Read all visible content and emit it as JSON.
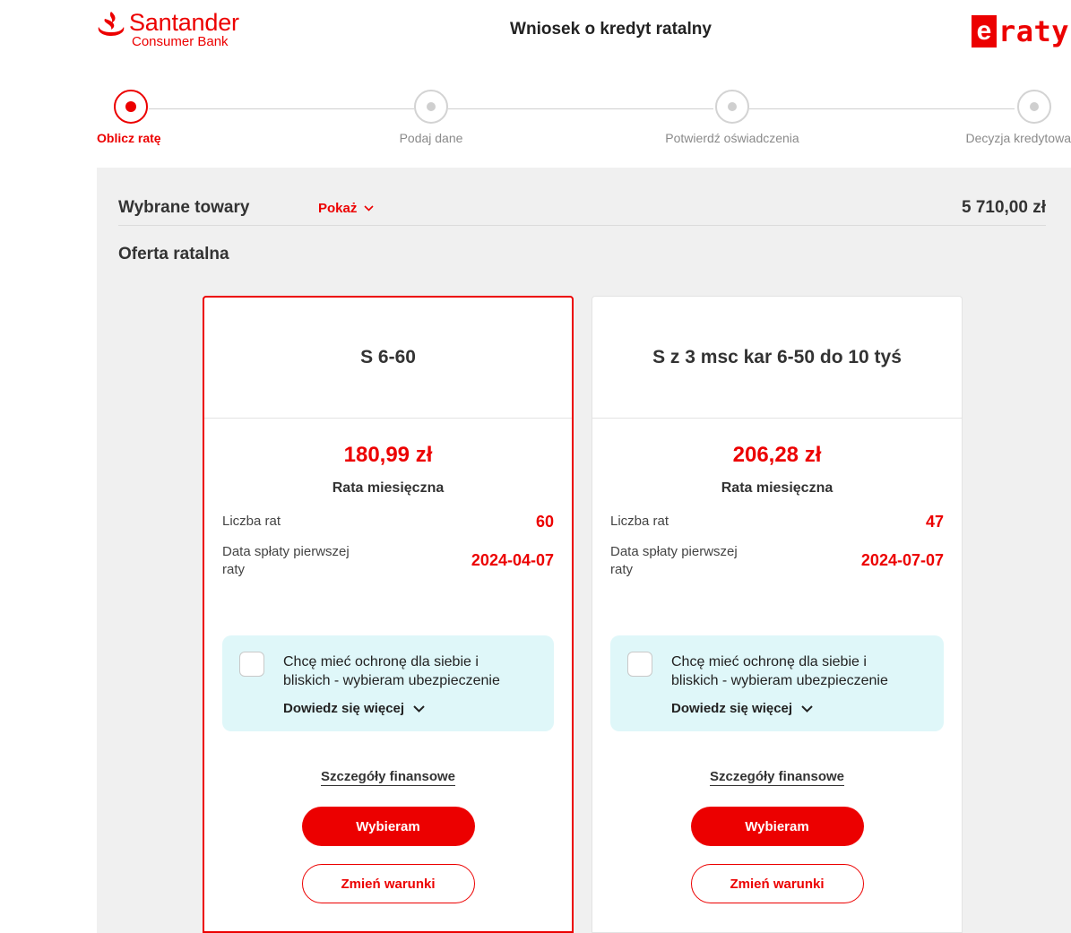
{
  "header": {
    "brand_main": "Santander",
    "brand_sub": "Consumer Bank",
    "title": "Wniosek o kredyt ratalny",
    "partner_logo_e": "e",
    "partner_logo_rest": "raty"
  },
  "stepper": {
    "steps": [
      {
        "label": "Oblicz ratę",
        "active": true
      },
      {
        "label": "Podaj dane",
        "active": false
      },
      {
        "label": "Potwierdź oświadczenia",
        "active": false
      },
      {
        "label": "Decyzja kredytowa",
        "active": false
      }
    ]
  },
  "goods": {
    "label": "Wybrane towary",
    "toggle_label": "Pokaż",
    "total": "5 710,00 zł"
  },
  "offer": {
    "title": "Oferta ratalna",
    "cards": [
      {
        "name": "S 6-60",
        "price": "180,99 zł",
        "price_label": "Rata miesięczna",
        "installments_label": "Liczba rat",
        "installments_value": "60",
        "first_payment_label": "Data spłaty pierwszej raty",
        "first_payment_value": "2024-04-07",
        "insurance_text": "Chcę mieć ochronę dla siebie i bliskich - wybieram ubezpieczenie",
        "insurance_more": "Dowiedz się więcej",
        "details_link": "Szczegóły finansowe",
        "choose_button": "Wybieram",
        "change_button": "Zmień warunki",
        "selected": true
      },
      {
        "name": "S z 3 msc kar 6-50 do 10 tyś",
        "price": "206,28 zł",
        "price_label": "Rata miesięczna",
        "installments_label": "Liczba rat",
        "installments_value": "47",
        "first_payment_label": "Data spłaty pierwszej raty",
        "first_payment_value": "2024-07-07",
        "insurance_text": "Chcę mieć ochronę dla siebie i bliskich - wybieram ubezpieczenie",
        "insurance_more": "Dowiedz się więcej",
        "details_link": "Szczegóły finansowe",
        "choose_button": "Wybieram",
        "change_button": "Zmień warunki",
        "selected": false
      }
    ]
  },
  "colors": {
    "accent": "#ec0000",
    "panel_bg": "#f0f0f0",
    "insurance_bg": "#dff7f9"
  },
  "icons": [
    "santander-flame-icon",
    "chevron-down-icon",
    "checkbox-icon"
  ]
}
